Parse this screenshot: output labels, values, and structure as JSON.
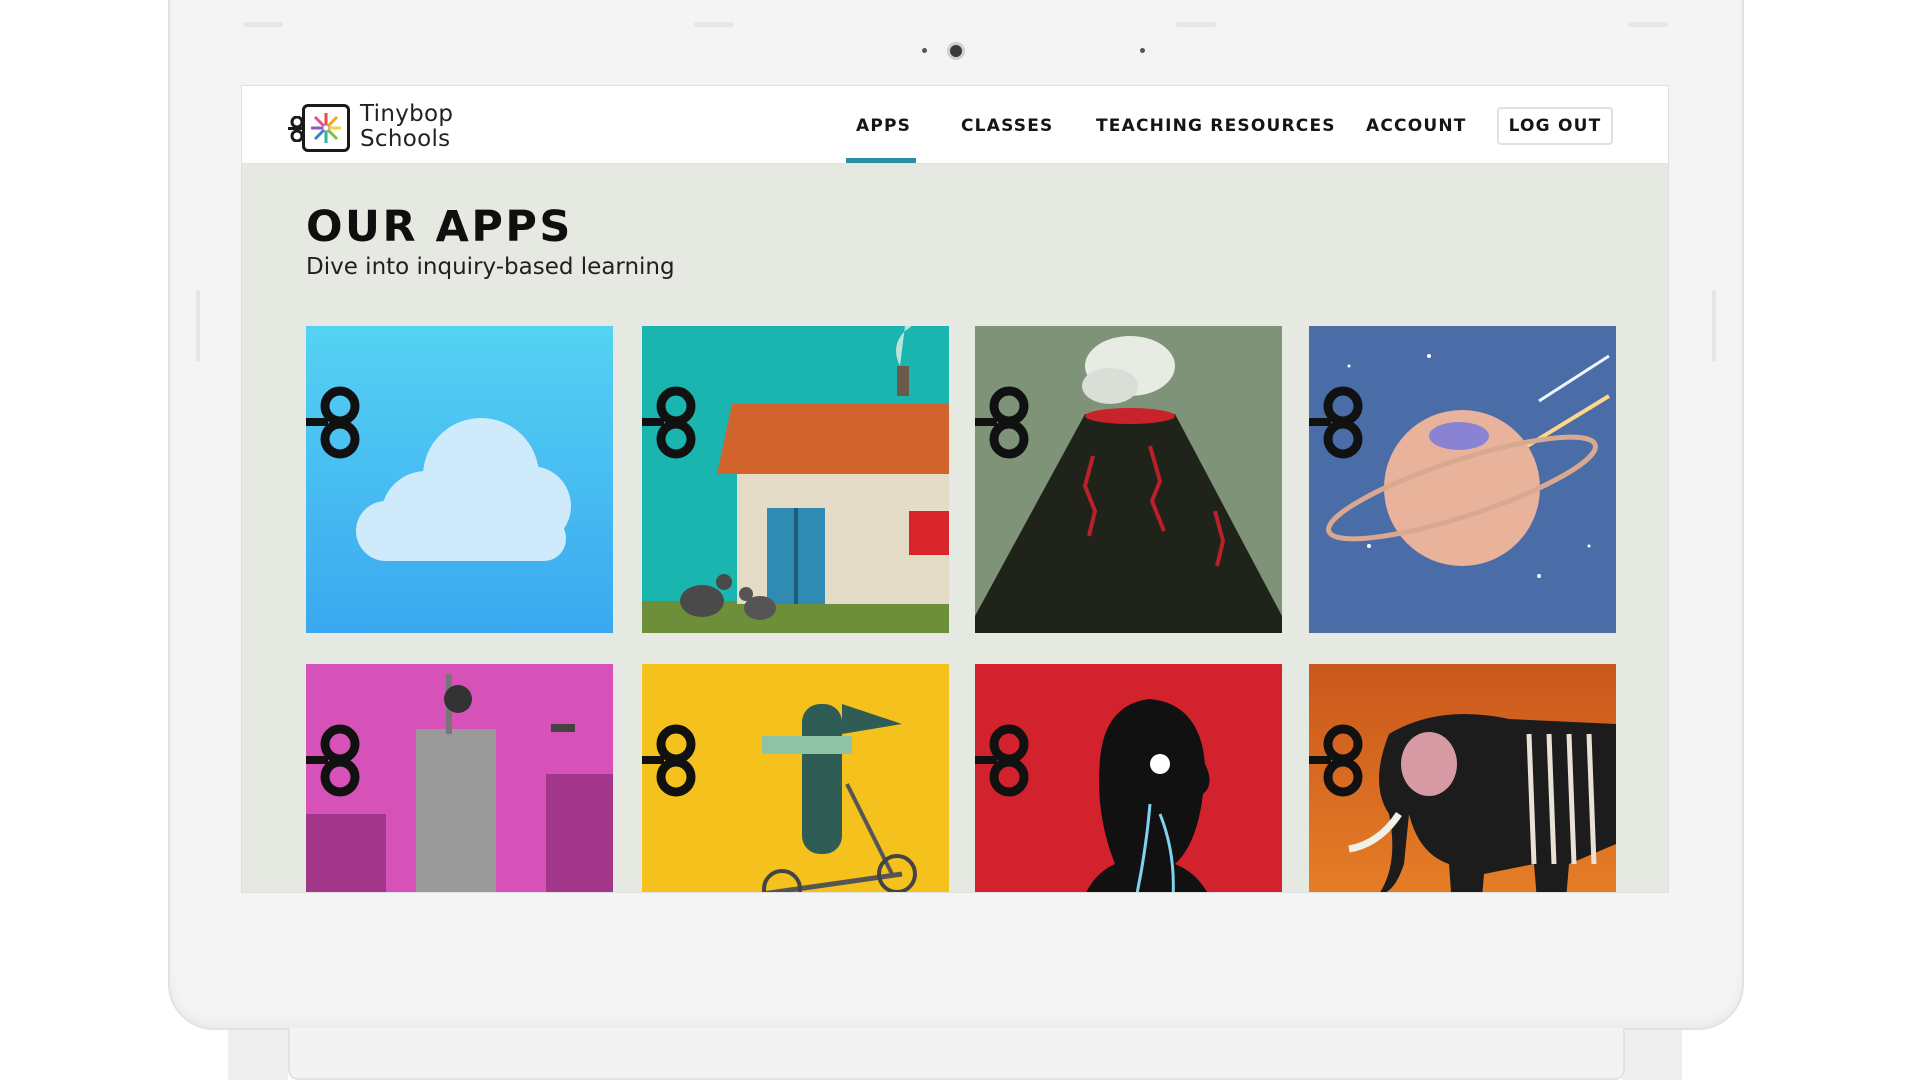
{
  "brand": {
    "line1": "Tinybop",
    "line2": "Schools"
  },
  "nav": {
    "items": [
      {
        "label": "APPS",
        "active": true
      },
      {
        "label": "CLASSES",
        "active": false
      },
      {
        "label": "TEACHING RESOURCES",
        "active": false
      },
      {
        "label": "ACCOUNT",
        "active": false
      }
    ],
    "logout_label": "LOG OUT",
    "active_color": "#2b8fa3"
  },
  "page": {
    "title": "OUR APPS",
    "subtitle": "Dive into inquiry-based learning"
  },
  "apps": [
    {
      "icon": "cloud-weather-icon"
    },
    {
      "icon": "house-chickens-icon"
    },
    {
      "icon": "volcano-icon"
    },
    {
      "icon": "planet-comet-icon"
    },
    {
      "icon": "city-skyscraper-icon"
    },
    {
      "icon": "bird-scooter-icon"
    },
    {
      "icon": "human-body-icon"
    },
    {
      "icon": "elephant-anatomy-icon"
    }
  ]
}
